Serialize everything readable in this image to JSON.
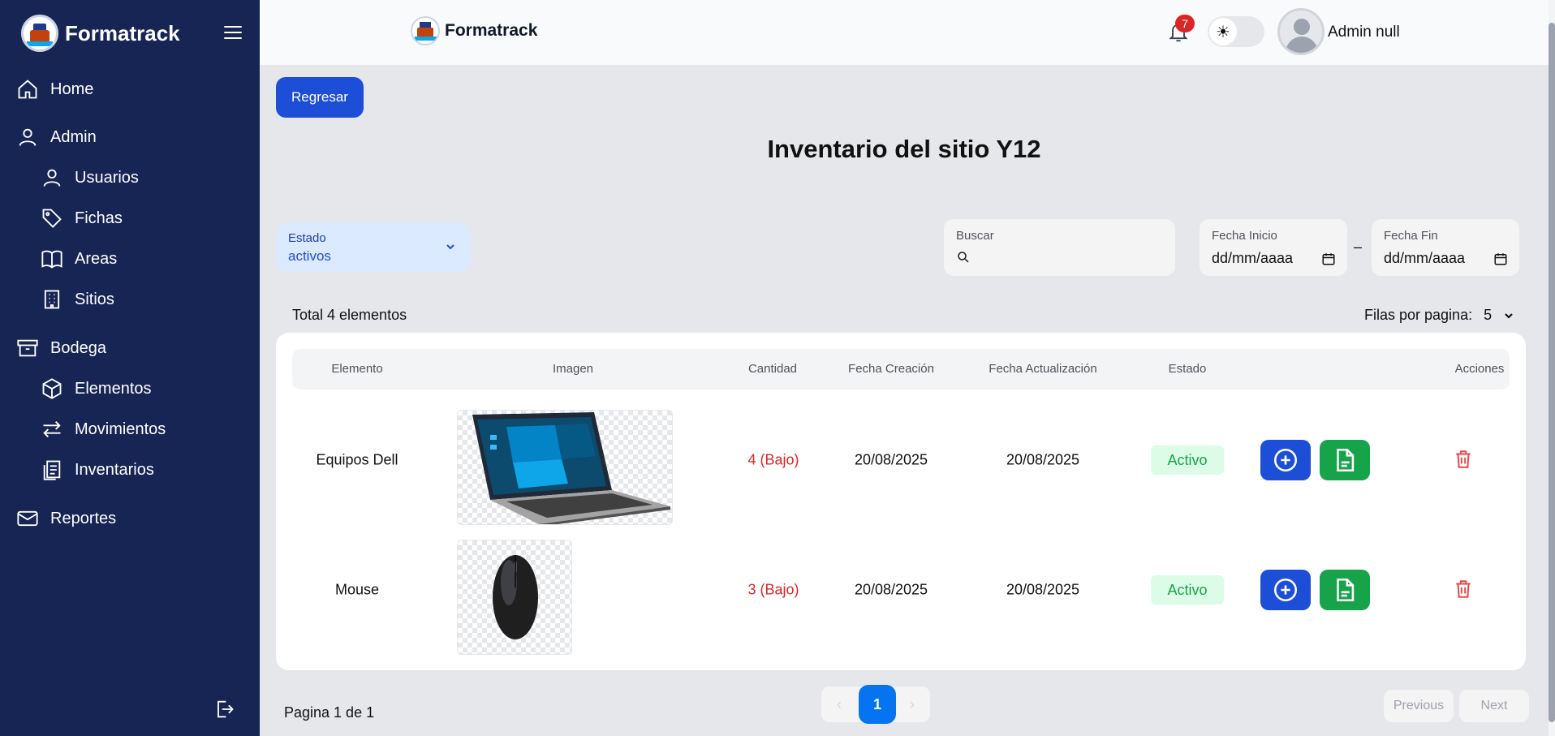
{
  "app": {
    "brand": "Formatrack"
  },
  "sidebar": {
    "items": [
      {
        "label": "Home",
        "icon": "home-icon"
      },
      {
        "label": "Admin",
        "icon": "user-icon"
      },
      {
        "label": "Usuarios",
        "icon": "user-icon"
      },
      {
        "label": "Fichas",
        "icon": "tag-icon"
      },
      {
        "label": "Areas",
        "icon": "book-icon"
      },
      {
        "label": "Sitios",
        "icon": "building-icon"
      },
      {
        "label": "Bodega",
        "icon": "archive-icon"
      },
      {
        "label": "Elementos",
        "icon": "cube-icon"
      },
      {
        "label": "Movimientos",
        "icon": "arrows-icon"
      },
      {
        "label": "Inventarios",
        "icon": "clipboard-icon"
      },
      {
        "label": "Reportes",
        "icon": "mail-icon"
      }
    ]
  },
  "topbar": {
    "notifications": "7",
    "user": "Admin null"
  },
  "main": {
    "back_label": "Regresar",
    "title": "Inventario del sitio Y12",
    "filters": {
      "estado_label": "Estado",
      "estado_value": "activos",
      "search_label": "Buscar",
      "search_value": "",
      "fecha_inicio_label": "Fecha Inicio",
      "fecha_inicio_value": "dd/mm/aaaa",
      "fecha_fin_label": "Fecha Fin",
      "fecha_fin_value": "dd/mm/aaaa",
      "separator": "–"
    },
    "total": "Total 4 elementos",
    "rows_per_page_label": "Filas por pagina:",
    "rows_per_page_value": "5"
  },
  "table": {
    "headers": [
      "Elemento",
      "Imagen",
      "Cantidad",
      "Fecha Creación",
      "Fecha Actualización",
      "Estado",
      "Acciones"
    ],
    "rows": [
      {
        "elemento": "Equipos Dell",
        "cantidad": "4  (Bajo)",
        "fecha_creacion": "20/08/2025",
        "fecha_actualizacion": "20/08/2025",
        "estado": "Activo",
        "image": "laptop"
      },
      {
        "elemento": "Mouse",
        "cantidad": "3  (Bajo)",
        "fecha_creacion": "20/08/2025",
        "fecha_actualizacion": "20/08/2025",
        "estado": "Activo",
        "image": "mouse"
      }
    ]
  },
  "pagination": {
    "info": "Pagina 1 de 1",
    "current": "1",
    "prev_symbol": "‹",
    "next_symbol": "›",
    "previous_label": "Previous",
    "next_label": "Next"
  },
  "colors": {
    "sidebar": "#172554",
    "primary": "#1d4ed8",
    "success": "#16a34a",
    "danger": "#dc2626"
  }
}
